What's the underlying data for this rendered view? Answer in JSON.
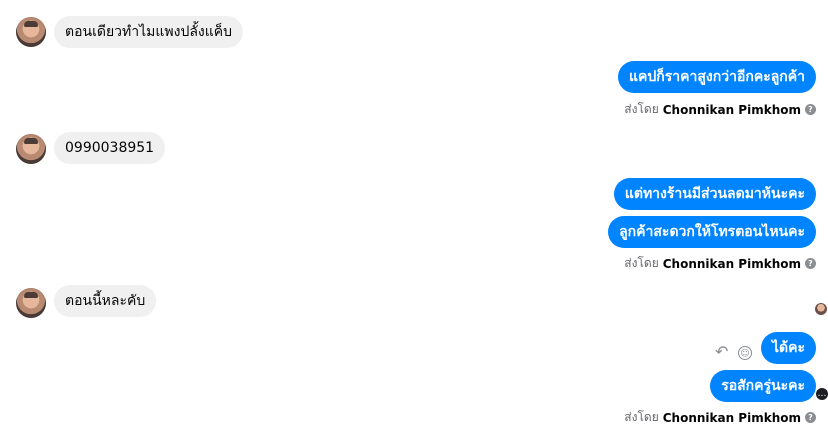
{
  "messages": [
    {
      "from": "in",
      "text": "ตอนเดียวทำไมแพงปลั้งแค็บ"
    },
    {
      "from": "out",
      "text": "แคปก็ราคาสูงกว่าอีกคะลูกค้า"
    },
    {
      "sent_label": "ส่งโดย",
      "sent_name": "Chonnikan Pimkhom"
    },
    {
      "from": "in",
      "text": "0990038951"
    },
    {
      "from": "out",
      "text": "แต่ทางร้านมีส่วนลดมาห้นะคะ"
    },
    {
      "from": "out",
      "text": "ลูกค้าสะดวกให้โทรตอนไหนคะ"
    },
    {
      "sent_label": "ส่งโดย",
      "sent_name": "Chonnikan Pimkhom"
    },
    {
      "from": "in",
      "text": "ตอนนี้หละคับ"
    },
    {
      "from": "out",
      "text": "ได้คะ"
    },
    {
      "from": "out",
      "text": "รอสักครู่นะคะ"
    },
    {
      "sent_label": "ส่งโดย",
      "sent_name": "Chonnikan Pimkhom"
    }
  ],
  "icons": {
    "info": "question-circle-icon",
    "reply": "reply-icon",
    "react": "smile-icon",
    "avatar": "contact-avatar"
  },
  "colors": {
    "outgoing_bubble": "#0084ff",
    "incoming_bubble": "#f0f0f0",
    "meta_text": "#65676b"
  }
}
